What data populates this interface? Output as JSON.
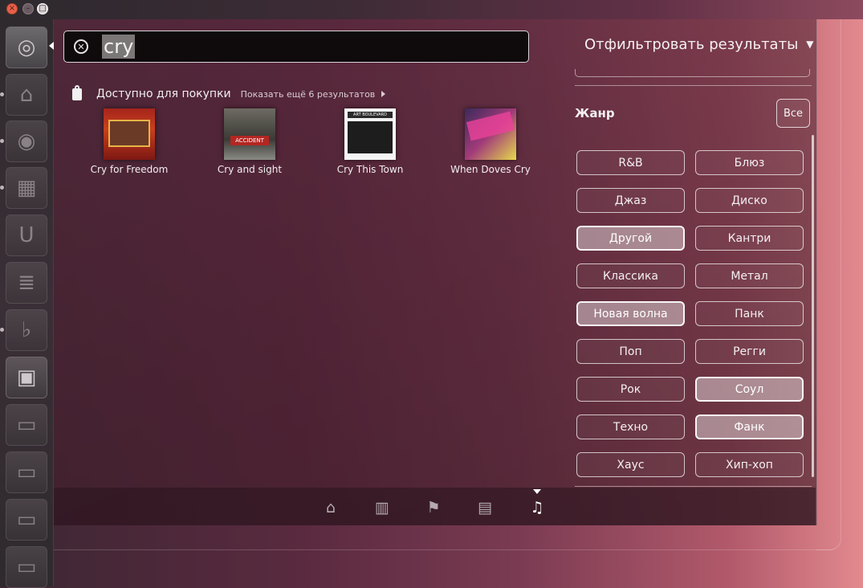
{
  "window": {
    "close_icon": "close-icon",
    "minimize_icon": "minimize-icon",
    "maximize_icon": "maximize-icon"
  },
  "launcher": {
    "items": [
      {
        "name": "ubuntu-logo-icon",
        "glyph": "◎"
      },
      {
        "name": "home-folder-icon",
        "glyph": "⌂"
      },
      {
        "name": "firefox-icon",
        "glyph": "◉"
      },
      {
        "name": "software-center-icon",
        "glyph": "▦"
      },
      {
        "name": "ubuntu-one-icon",
        "glyph": "U"
      },
      {
        "name": "libreoffice-writer-icon",
        "glyph": "≣"
      },
      {
        "name": "banshee-icon",
        "glyph": "♭"
      },
      {
        "name": "workspace-switcher-icon",
        "glyph": "▣"
      },
      {
        "name": "drive-icon",
        "glyph": "▭"
      },
      {
        "name": "drive-icon",
        "glyph": "▭"
      },
      {
        "name": "drive-icon",
        "glyph": "▭"
      },
      {
        "name": "drive-icon",
        "glyph": "▭"
      }
    ]
  },
  "search": {
    "value": "cry",
    "clear_icon": "clear-search-icon"
  },
  "filter_toggle": {
    "label": "Отфильтровать результаты",
    "caret": "▼"
  },
  "category": {
    "title": "Доступно для покупки",
    "more": "Показать ещё 6 результатов",
    "results": [
      {
        "title": "Cry for Freedom"
      },
      {
        "title": "Cry and sight"
      },
      {
        "title": "Cry This Town"
      },
      {
        "title": "When Doves Cry"
      }
    ]
  },
  "covers": {
    "cry_and_sight_text": "ACCIDENT",
    "cry_this_town_text": "ART BOULEVARD"
  },
  "filters": {
    "genre_title": "Жанр",
    "all_label": "Все",
    "genres": [
      {
        "label": "R&B",
        "selected": false
      },
      {
        "label": "Блюз",
        "selected": false
      },
      {
        "label": "Джаз",
        "selected": false
      },
      {
        "label": "Диско",
        "selected": false
      },
      {
        "label": "Другой",
        "selected": true
      },
      {
        "label": "Кантри",
        "selected": false
      },
      {
        "label": "Классика",
        "selected": false
      },
      {
        "label": "Метал",
        "selected": false
      },
      {
        "label": "Новая волна",
        "selected": true
      },
      {
        "label": "Панк",
        "selected": false
      },
      {
        "label": "Поп",
        "selected": false
      },
      {
        "label": "Регги",
        "selected": false
      },
      {
        "label": "Рок",
        "selected": false
      },
      {
        "label": "Соул",
        "selected": true
      },
      {
        "label": "Техно",
        "selected": false
      },
      {
        "label": "Фанк",
        "selected": true
      },
      {
        "label": "Хаус",
        "selected": false
      },
      {
        "label": "Хип-хоп",
        "selected": false
      }
    ]
  },
  "lenses": [
    {
      "name": "home-lens-icon",
      "glyph": "⌂",
      "active": false
    },
    {
      "name": "applications-lens-icon",
      "glyph": "▥",
      "active": false
    },
    {
      "name": "bookmark-lens-icon",
      "glyph": "⚑",
      "active": false
    },
    {
      "name": "files-lens-icon",
      "glyph": "▤",
      "active": false
    },
    {
      "name": "music-lens-icon",
      "glyph": "♫",
      "active": true
    }
  ]
}
